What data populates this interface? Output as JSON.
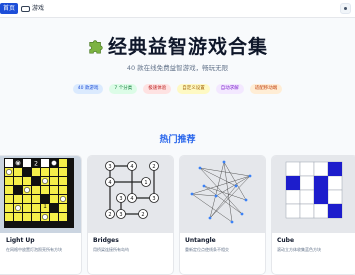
{
  "nav": {
    "home_label": "首页",
    "games_label": "游戏"
  },
  "hero": {
    "title": "经典益智游戏合集",
    "subtitle": "40 款在线免费益智游戏，畅玩无限",
    "tags": [
      {
        "label": "40 款游戏",
        "bg": "#dbeafe",
        "fg": "#1d4ed8"
      },
      {
        "label": "7 个分类",
        "bg": "#dcfce7",
        "fg": "#15803d"
      },
      {
        "label": "极速体验",
        "bg": "#fee2e2",
        "fg": "#b91c1c"
      },
      {
        "label": "自定义设置",
        "bg": "#fef9c3",
        "fg": "#a16207"
      },
      {
        "label": "自动求解",
        "bg": "#f3e8ff",
        "fg": "#7e22ce"
      },
      {
        "label": "适配移动端",
        "bg": "#ffedd5",
        "fg": "#c2410c"
      }
    ]
  },
  "featured": {
    "title": "热门推荐",
    "cards": [
      {
        "name": "Light Up",
        "desc": "在网格中放置灯泡照亮所有方块"
      },
      {
        "name": "Bridges",
        "desc": "用桥梁连接所有岛屿"
      },
      {
        "name": "Untangle",
        "desc": "重新定位点使线条不相交"
      },
      {
        "name": "Cube",
        "desc": "滚动立方体收集蓝色方块"
      }
    ]
  },
  "colors": {
    "accent": "#2563eb",
    "lightup_yellow": "#f5ef4a",
    "cube_blue": "#1d1dcc"
  }
}
